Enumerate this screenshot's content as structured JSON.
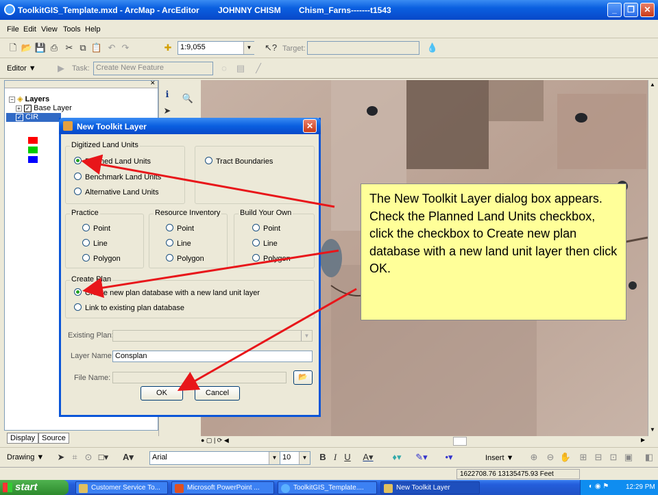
{
  "window": {
    "title": "ToolkitGIS_Template.mxd - ArcMap - ArcEditor",
    "user": "JOHNNY CHISM",
    "document": "Chism_Farns-------t1543"
  },
  "menu": [
    "File",
    "Edit",
    "View",
    "Tools",
    "Help"
  ],
  "standard_toolbar": {
    "scale": "1:9,055",
    "target_label": "Target:"
  },
  "editor_toolbar": {
    "editor_label": "Editor",
    "task_label": "Task:",
    "task_value": "Create New Feature"
  },
  "toc": {
    "root": "Layers",
    "items": [
      "Base Layer",
      "CIR"
    ]
  },
  "toc_tabs": [
    "Display",
    "Source"
  ],
  "dialog": {
    "title": "New Toolkit Layer",
    "digitized": {
      "label": "Digitized Land Units",
      "options": [
        "Planned Land Units",
        "Benchmark Land Units",
        "Alternative Land Units"
      ],
      "selected": "Planned Land Units"
    },
    "tract": {
      "label": "Tract Boundaries"
    },
    "practice": {
      "label": "Practice",
      "options": [
        "Point",
        "Line",
        "Polygon"
      ]
    },
    "resource": {
      "label": "Resource Inventory",
      "options": [
        "Point",
        "Line",
        "Polygon"
      ]
    },
    "build": {
      "label": "Build Your Own",
      "options": [
        "Point",
        "Line",
        "Polygon"
      ]
    },
    "create_plan": {
      "label": "Create Plan",
      "options": [
        "Create new plan database with a new land unit layer",
        "Link to existing plan database"
      ],
      "selected": "Create new plan database with a new land unit layer"
    },
    "existing_plan_label": "Existing Plan:",
    "layer_name_label": "Layer Name:",
    "layer_name_value": "Consplan",
    "file_name_label": "File Name:",
    "ok": "OK",
    "cancel": "Cancel"
  },
  "callout": "The New Toolkit Layer dialog box appears. Check the Planned Land Units checkbox, click the checkbox to Create new plan database with a new land unit layer then click OK.",
  "drawing_toolbar": {
    "drawing_label": "Drawing",
    "font": "Arial",
    "size": "10",
    "insert_label": "Insert"
  },
  "status": {
    "coords": "1622708.76  13135475.93 Feet"
  },
  "taskbar": {
    "start": "start",
    "tasks": [
      "Customer Service To...",
      "Microsoft PowerPoint ...",
      "ToolkitGIS_Template....",
      "New Toolkit Layer"
    ],
    "time": "12:29 PM"
  },
  "colors": {
    "arrow": "#e8161a",
    "callout_bg": "#ffff99",
    "xp_blue": "#0a5fe0"
  }
}
